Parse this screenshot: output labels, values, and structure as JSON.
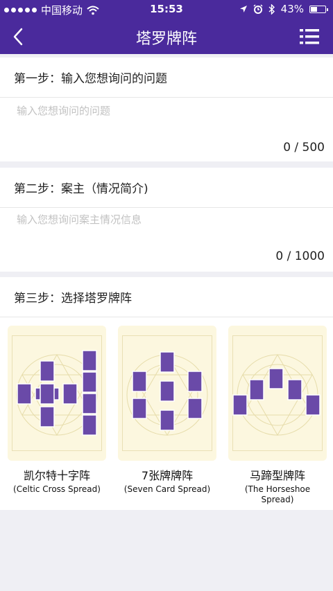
{
  "status_bar": {
    "carrier": "中国移动",
    "time": "15:53",
    "battery": "43%",
    "battery_level": 0.43,
    "icons": [
      "signal-dots",
      "wifi-icon",
      "location-icon",
      "alarm-icon",
      "bluetooth-icon",
      "battery-icon"
    ]
  },
  "nav": {
    "title": "塔罗牌阵",
    "back_icon": "chevron-left-icon",
    "menu_icon": "list-menu-icon"
  },
  "colors": {
    "nav_bg": "#4a2a9c",
    "card_bg": "#fcf7df",
    "tarot_card": "#6a4aa8"
  },
  "step1": {
    "heading": "第一步：输入您想询问的问题",
    "placeholder": "输入您想询问的问题",
    "counter": "0 / 500"
  },
  "step2": {
    "heading": "第二步：案主（情况简介)",
    "placeholder": "输入您想询问案主情况信息",
    "counter": "0 / 1000"
  },
  "step3": {
    "heading": "第三步：选择塔罗牌阵",
    "spreads": [
      {
        "name": "凯尔特十字阵",
        "en": "(Celtic Cross Spread)"
      },
      {
        "name": "7张牌牌阵",
        "en": "(Seven Card Spread)"
      },
      {
        "name": "马蹄型牌阵",
        "en": "(The Horseshoe Spread)"
      }
    ]
  }
}
